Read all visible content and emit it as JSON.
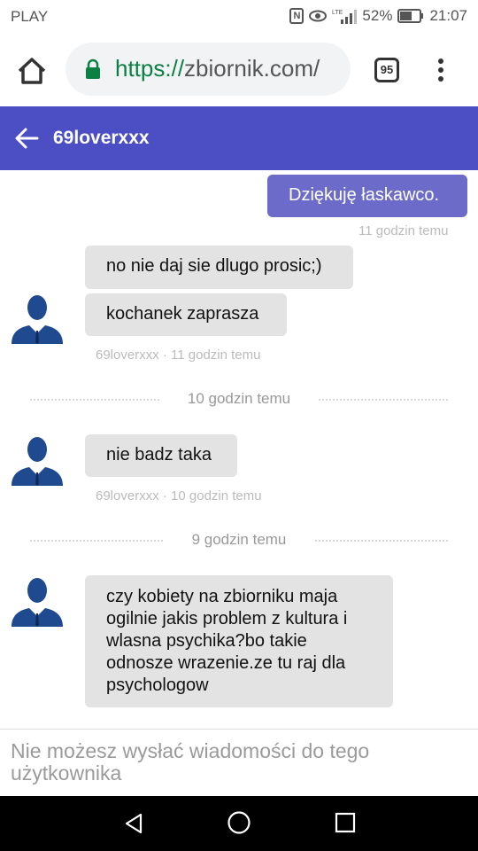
{
  "statusbar": {
    "carrier": "PLAY",
    "battery": "52%",
    "time": "21:07",
    "icons": [
      "nfc-icon",
      "eye-icon",
      "lte-signal-icon",
      "battery-icon"
    ]
  },
  "browser": {
    "url_scheme": "https://",
    "url_host": "zbiornik.com/",
    "tab_count": "95",
    "icons": [
      "home-icon",
      "lock-icon",
      "tabs-icon",
      "overflow-menu-icon"
    ],
    "lock_color": "#0b8043"
  },
  "chat": {
    "title": "69loverxxx",
    "header_color": "#4b4fc3",
    "outgoing_color": "#6d6bc9",
    "incoming_color": "#e3e3e3",
    "messages": [
      {
        "text": "Dziękuję łaskawco.",
        "direction": "out"
      },
      {
        "text": "11 godzin temu",
        "type": "meta"
      },
      {
        "text": "no nie daj sie dlugo prosic;)",
        "direction": "in"
      },
      {
        "text": "kochanek zaprasza",
        "direction": "in"
      },
      {
        "text": "69loverxxx · 11 godzin temu",
        "type": "meta"
      },
      {
        "text": "10 godzin temu",
        "type": "divider"
      },
      {
        "text": "nie badz taka",
        "direction": "in"
      },
      {
        "text": "69loverxxx · 10 godzin temu",
        "type": "meta"
      },
      {
        "text": "9 godzin temu",
        "type": "divider"
      },
      {
        "text": "czy kobiety na zbiorniku maja ogilnie jakis problem z kultura i wlasna psychika?bo takie odnosze wrazenie.ze tu raj dla psychologow",
        "direction": "in"
      }
    ]
  },
  "footer": {
    "notice": "Nie możesz wysłać wiadomości do tego użytkownika"
  },
  "navbar": {
    "icons": [
      "nav-back-icon",
      "nav-home-icon",
      "nav-recent-icon"
    ]
  }
}
